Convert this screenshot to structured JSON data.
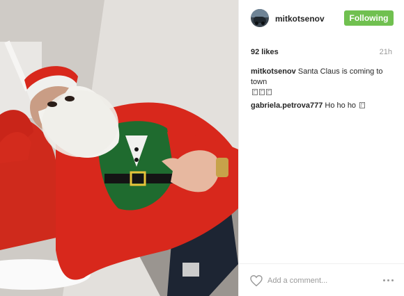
{
  "post": {
    "username": "mitkotsenov",
    "follow_label": "Following",
    "likes": "92 likes",
    "time": "21h",
    "caption": {
      "author": "mitkotsenov",
      "text": "Santa Claus is coming to town"
    },
    "comments": [
      {
        "author": "gabriela.petrova777",
        "text": "Ho ho ho"
      }
    ],
    "add_comment_placeholder": "Add a comment...",
    "colors": {
      "follow_button": "#70c050",
      "sweater_red": "#d8281c",
      "text": "#262626",
      "muted": "#999999"
    },
    "icons": [
      "heart-icon",
      "more-options-icon"
    ]
  }
}
